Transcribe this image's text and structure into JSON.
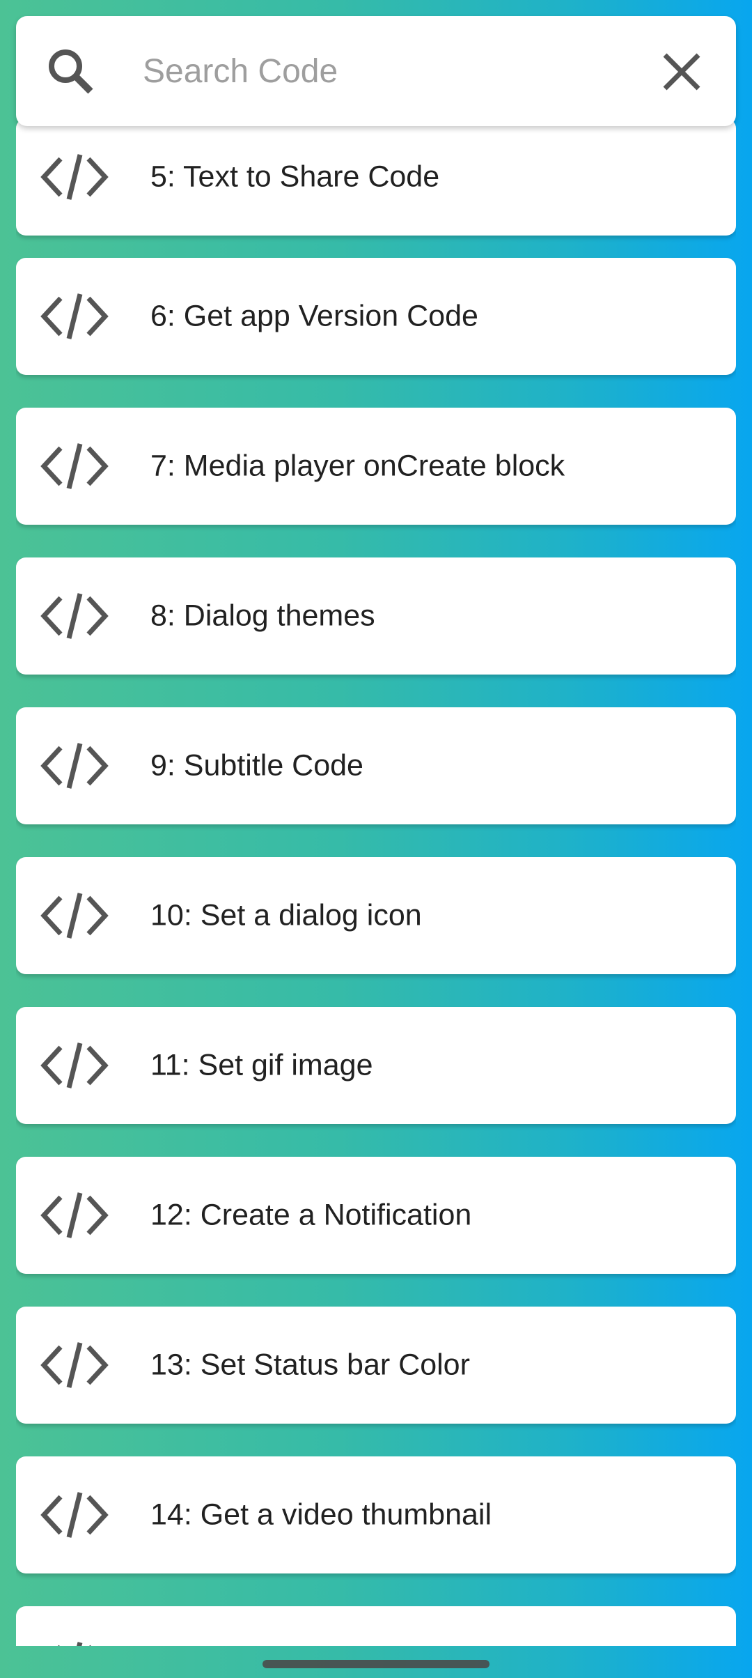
{
  "search": {
    "placeholder": "Search Code",
    "value": ""
  },
  "items": [
    {
      "label": "5: Text to Share Code",
      "icon": "code-icon"
    },
    {
      "label": "6: Get app Version Code",
      "icon": "code-icon"
    },
    {
      "label": "7: Media player onCreate block",
      "icon": "code-icon"
    },
    {
      "label": "8: Dialog themes",
      "icon": "code-icon"
    },
    {
      "label": "9: Subtitle Code",
      "icon": "code-icon"
    },
    {
      "label": "10: Set a dialog icon",
      "icon": "code-icon"
    },
    {
      "label": "11: Set gif image",
      "icon": "code-icon"
    },
    {
      "label": "12: Create a Notification",
      "icon": "code-icon"
    },
    {
      "label": "13: Set Status bar Color",
      "icon": "code-icon"
    },
    {
      "label": "14: Get a video thumbnail",
      "icon": "code-icon"
    },
    {
      "label": "",
      "icon": "code-icon"
    }
  ],
  "colors": {
    "background_start": "#4cc295",
    "background_end": "#08a6ef",
    "card": "#ffffff",
    "icon": "#555555",
    "text": "#212121",
    "placeholder": "#9e9e9e"
  }
}
